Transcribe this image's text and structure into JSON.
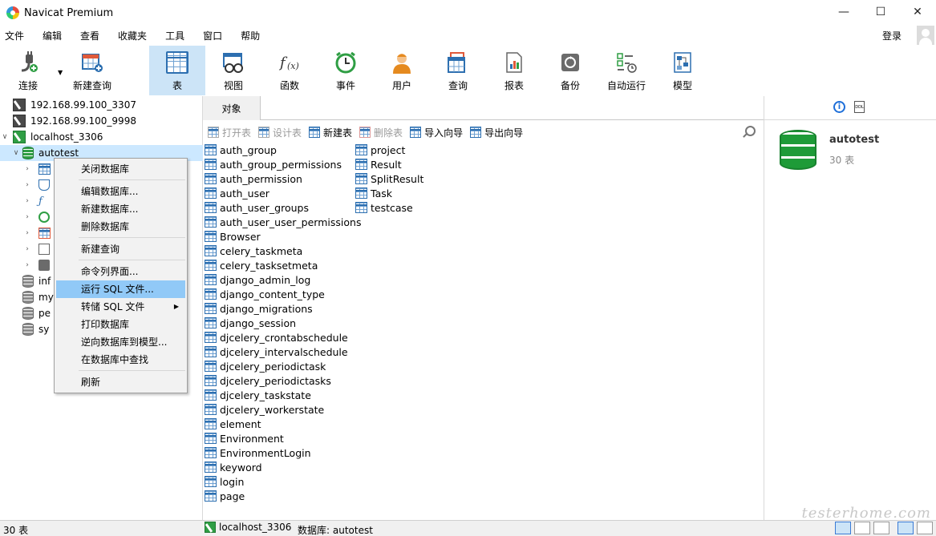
{
  "window": {
    "title": "Navicat Premium",
    "minimize": "—",
    "maximize": "☐",
    "close": "✕"
  },
  "menu": [
    "文件",
    "编辑",
    "查看",
    "收藏夹",
    "工具",
    "窗口",
    "帮助"
  ],
  "login": "登录",
  "toolbar": {
    "connect": "连接",
    "new_query": "新建查询",
    "table": "表",
    "view": "视图",
    "function": "函数",
    "event": "事件",
    "user": "用户",
    "query": "查询",
    "report": "报表",
    "backup": "备份",
    "automation": "自动运行",
    "model": "模型"
  },
  "tree": {
    "connections": [
      "192.168.99.100_3307",
      "192.168.99.100_9998",
      "localhost_3306"
    ],
    "selected_db": "autotest",
    "other_dbs": [
      "inf",
      "my",
      "pe",
      "sy"
    ]
  },
  "context_menu": {
    "close_db": "关闭数据库",
    "edit_db": "编辑数据库...",
    "new_db": "新建数据库...",
    "delete_db": "删除数据库",
    "new_query": "新建查询",
    "console": "命令列界面...",
    "run_sql": "运行 SQL 文件...",
    "dump_sql": "转储 SQL 文件",
    "print_db": "打印数据库",
    "reverse_model": "逆向数据库到模型...",
    "find_in_db": "在数据库中查找",
    "refresh": "刷新"
  },
  "tab": {
    "objects": "对象"
  },
  "objbar": {
    "open": "打开表",
    "design": "设计表",
    "new": "新建表",
    "delete": "删除表",
    "import": "导入向导",
    "export": "导出向导"
  },
  "tables_col1": [
    "auth_group",
    "auth_group_permissions",
    "auth_permission",
    "auth_user",
    "auth_user_groups",
    "auth_user_user_permissions",
    "Browser",
    "celery_taskmeta",
    "celery_tasksetmeta",
    "django_admin_log",
    "django_content_type",
    "django_migrations",
    "django_session",
    "djcelery_crontabschedule",
    "djcelery_intervalschedule",
    "djcelery_periodictask",
    "djcelery_periodictasks",
    "djcelery_taskstate",
    "djcelery_workerstate",
    "element",
    "Environment",
    "EnvironmentLogin",
    "keyword",
    "login",
    "page"
  ],
  "tables_col2": [
    "project",
    "Result",
    "SplitResult",
    "Task",
    "testcase"
  ],
  "info": {
    "name": "autotest",
    "count": "30 表",
    "ddl": "DDL"
  },
  "status": {
    "count": "30 表",
    "connection": "localhost_3306",
    "database": "数据库: autotest"
  },
  "watermark": "testerhome.com"
}
